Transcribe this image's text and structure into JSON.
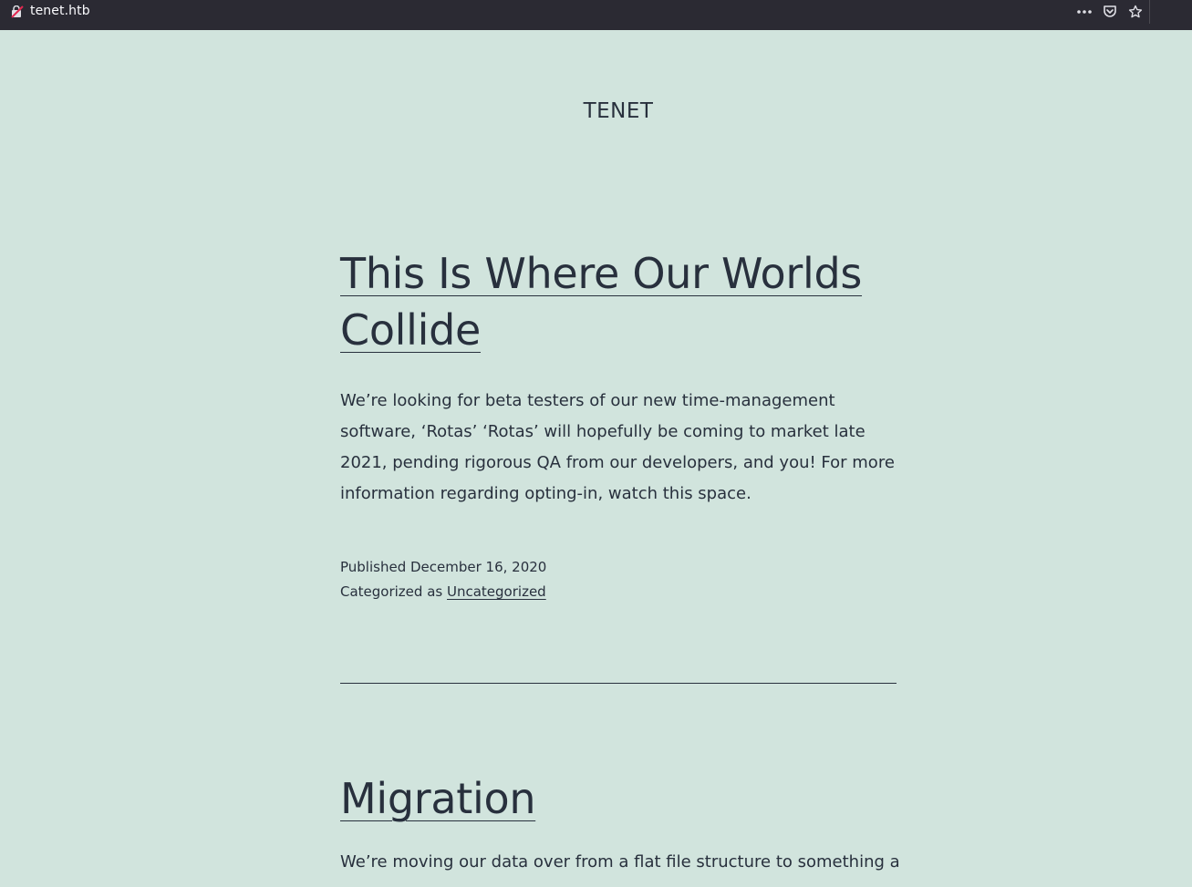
{
  "browser": {
    "url": "tenet.htb",
    "icons": [
      "page-actions-menu-icon",
      "pocket-icon",
      "bookmark-star-icon"
    ]
  },
  "site": {
    "title": "TENET"
  },
  "posts": [
    {
      "title_line1": "This Is Where Our Worlds",
      "title_line2": "Collide",
      "excerpt_lines": [
        "We’re looking for beta testers of our new time-management",
        "software, ‘Rotas’ ‘Rotas’ will hopefully be coming to market late",
        "2021, pending rigorous QA from our developers, and you! For more",
        "information regarding opting-in, watch this space."
      ],
      "published": "Published December 16, 2020",
      "categorized_prefix": "Categorized as",
      "category": "Uncategorized"
    },
    {
      "title": "Migration",
      "excerpt_first_line": "We’re moving our data over from a flat file structure to something a"
    }
  ],
  "colors": {
    "background": "#d1e4dd",
    "text": "#28303d",
    "toolbar": "#2b2a33"
  }
}
